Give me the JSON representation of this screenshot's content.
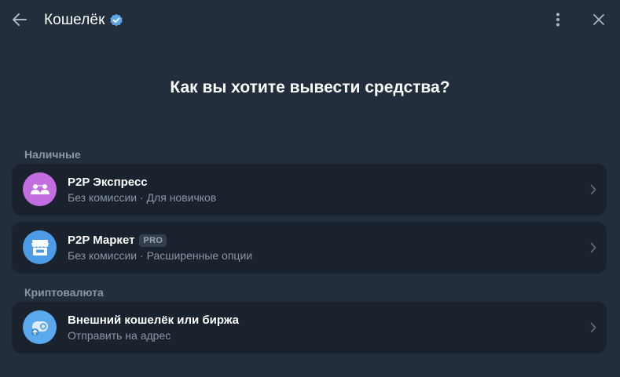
{
  "header": {
    "title": "Кошелёк",
    "back_icon": "arrow-left-icon",
    "verified_icon": "verified-badge-icon",
    "more_icon": "more-vertical-icon",
    "close_icon": "close-icon"
  },
  "main": {
    "title": "Как вы хотите вывести средства?"
  },
  "sections": {
    "cash": {
      "label": "Наличные",
      "items": [
        {
          "name": "P2P Экспресс",
          "subtitle": "Без комиссии · Для новичков",
          "icon": "people-icon",
          "color": "#c26ee0"
        },
        {
          "name": "P2P Маркет",
          "badge": "PRO",
          "subtitle": "Без комиссии · Расширенные опции",
          "icon": "store-icon",
          "color": "#4d9be6"
        }
      ]
    },
    "crypto": {
      "label": "Криптовалюта",
      "items": [
        {
          "name": "Внешний кошелёк или биржа",
          "subtitle": "Отправить на адрес",
          "icon": "wallet-send-icon",
          "color": "#5aa9ee"
        }
      ]
    }
  },
  "colors": {
    "background": "#232e3c",
    "card": "#1a222e",
    "muted_text": "#8b96a3",
    "verified": "#5ea7e8"
  }
}
